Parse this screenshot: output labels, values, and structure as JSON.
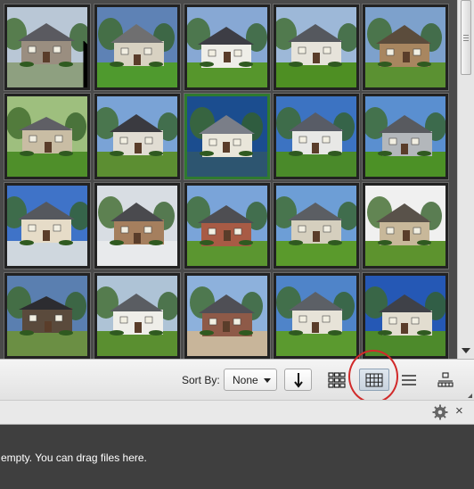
{
  "gallery": {
    "thumbnails": [
      {
        "label": "house-thumbnail-1",
        "sky": "#b9c7d6",
        "ground": "#8ea080",
        "wall": "#9a8e80",
        "roof": "#5a5a60",
        "cursor": true
      },
      {
        "label": "house-thumbnail-2",
        "sky": "#5e82b5",
        "ground": "#4f9a2e",
        "wall": "#d8d2c2",
        "roof": "#6f6f70"
      },
      {
        "label": "house-thumbnail-3",
        "sky": "#87a8d4",
        "ground": "#56962c",
        "wall": "#efeee8",
        "roof": "#3d3d45"
      },
      {
        "label": "house-thumbnail-4",
        "sky": "#9db8d8",
        "ground": "#4e8f23",
        "wall": "#e6e3da",
        "roof": "#55585e"
      },
      {
        "label": "house-thumbnail-5",
        "sky": "#7da1cc",
        "ground": "#5b9132",
        "wall": "#a88660",
        "roof": "#5b4c3c"
      },
      {
        "label": "house-thumbnail-6",
        "sky": "#9ebf7e",
        "ground": "#4f8f2a",
        "wall": "#c9bda4",
        "roof": "#5f5f65"
      },
      {
        "label": "house-thumbnail-7",
        "sky": "#7aa3d6",
        "ground": "#5c8e32",
        "wall": "#e1ddd3",
        "roof": "#3a3a40"
      },
      {
        "label": "house-thumbnail-8",
        "sky": "#1b4d8f",
        "ground": "#2d5570",
        "wall": "#e9e6da",
        "roof": "#7a7e88",
        "selected": true
      },
      {
        "label": "house-thumbnail-9",
        "sky": "#3c73c2",
        "ground": "#4a8a2a",
        "wall": "#e8e8e6",
        "roof": "#585c66"
      },
      {
        "label": "house-thumbnail-10",
        "sky": "#5a8fd0",
        "ground": "#4c9126",
        "wall": "#b3b7bb",
        "roof": "#585a5f"
      },
      {
        "label": "house-thumbnail-11",
        "sky": "#3f73c8",
        "ground": "#cfd7de",
        "wall": "#e6dcc8",
        "roof": "#55585e"
      },
      {
        "label": "house-thumbnail-12",
        "sky": "#d8dde3",
        "ground": "#e8eaec",
        "wall": "#a57f5e",
        "roof": "#4a4a4e"
      },
      {
        "label": "house-thumbnail-13",
        "sky": "#7aa4d9",
        "ground": "#5b9630",
        "wall": "#a85b45",
        "roof": "#4e4e52"
      },
      {
        "label": "house-thumbnail-14",
        "sky": "#6d9ed6",
        "ground": "#5a9a2c",
        "wall": "#d5cfbe",
        "roof": "#5b5e63"
      },
      {
        "label": "house-thumbnail-15",
        "sky": "#f0f0f0",
        "ground": "#5d932e",
        "wall": "#c8b89a",
        "roof": "#59524a"
      },
      {
        "label": "house-thumbnail-16",
        "sky": "#5a7fb0",
        "ground": "#6b8f44",
        "wall": "#5a4a3c",
        "roof": "#2c2c30"
      },
      {
        "label": "house-thumbnail-17",
        "sky": "#aec3d6",
        "ground": "#5a8f30",
        "wall": "#efeee9",
        "roof": "#5a5d62"
      },
      {
        "label": "house-thumbnail-18",
        "sky": "#8db1dc",
        "ground": "#c8b59a",
        "wall": "#8e5a48",
        "roof": "#4f4f55"
      },
      {
        "label": "house-thumbnail-19",
        "sky": "#4f84c9",
        "ground": "#5b9a2f",
        "wall": "#e7e3d8",
        "roof": "#5c6066"
      },
      {
        "label": "house-thumbnail-20",
        "sky": "#2558b5",
        "ground": "#4d8a2b",
        "wall": "#e2ddd0",
        "roof": "#3f4148"
      }
    ]
  },
  "toolbar": {
    "sort_by_label": "Sort By:",
    "sort_value": "None",
    "highlight_color": "#d12a2a",
    "icons": {
      "sort_direction": "down-arrow-icon",
      "large_thumbnails": "large-grid-icon",
      "medium_thumbnails": "medium-grid-icon",
      "list": "list-view-icon",
      "details": "details-view-icon"
    },
    "active_view": "medium_thumbnails"
  },
  "panel": {
    "message": "empty. You can drag files here.",
    "icons": {
      "settings": "gear-icon",
      "close": "close-icon"
    },
    "close_glyph": "×"
  }
}
